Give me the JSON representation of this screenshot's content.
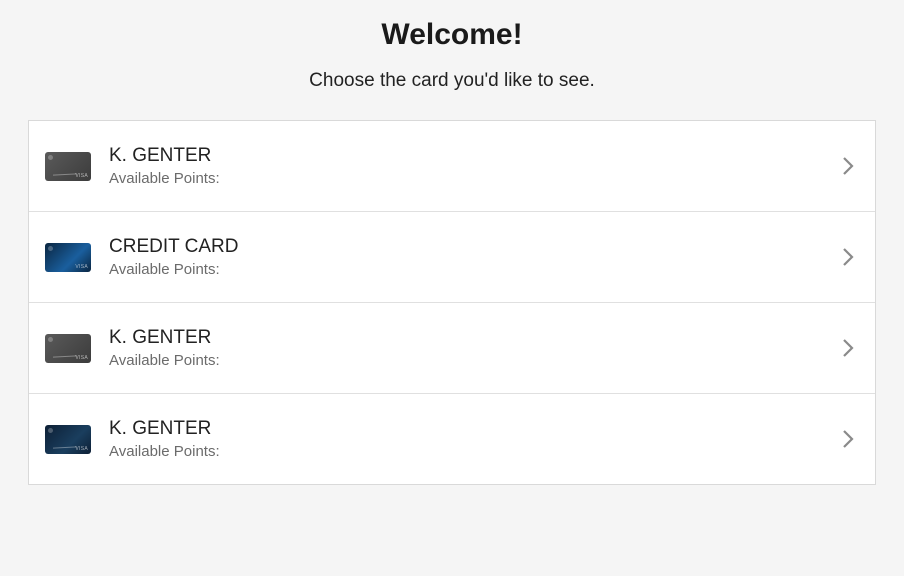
{
  "header": {
    "title": "Welcome!",
    "subtitle": "Choose the card you'd like to see."
  },
  "cards": [
    {
      "name": "K. GENTER",
      "points_label": "Available Points:",
      "thumb_style": "dark"
    },
    {
      "name": "CREDIT CARD",
      "points_label": "Available Points:",
      "thumb_style": "blue"
    },
    {
      "name": "K. GENTER",
      "points_label": "Available Points:",
      "thumb_style": "dark"
    },
    {
      "name": "K. GENTER",
      "points_label": "Available Points:",
      "thumb_style": "blue2"
    }
  ]
}
